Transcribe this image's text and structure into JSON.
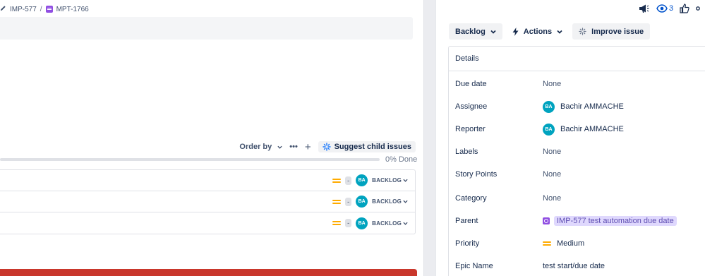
{
  "breadcrumb": {
    "epic": "IMP-577",
    "separator": "/",
    "story": "MPT-1766"
  },
  "child_issues": {
    "order_label": "Order by",
    "more_label": "•••",
    "add_label": "+",
    "suggest_label": "Suggest child issues",
    "progress_percent": 0,
    "progress_text": "0% Done",
    "rows": [
      {
        "estimate": "-",
        "assignee_initials": "BA",
        "status": "BACKLOG"
      },
      {
        "estimate": "-",
        "assignee_initials": "BA",
        "status": "BACKLOG"
      },
      {
        "estimate": "-",
        "assignee_initials": "BA",
        "status": "BACKLOG"
      }
    ]
  },
  "header_icons": {
    "watch_count": "3"
  },
  "actions": {
    "status_label": "Backlog",
    "actions_label": "Actions",
    "improve_label": "Improve issue"
  },
  "details": {
    "heading": "Details",
    "fields": {
      "due_date": {
        "label": "Due date",
        "value": "None"
      },
      "assignee": {
        "label": "Assignee",
        "initials": "BA",
        "value": "Bachir AMMACHE"
      },
      "reporter": {
        "label": "Reporter",
        "initials": "BA",
        "value": "Bachir AMMACHE"
      },
      "labels": {
        "label": "Labels",
        "value": "None"
      },
      "story_points": {
        "label": "Story Points",
        "value": "None"
      },
      "category": {
        "label": "Category",
        "value": "None"
      },
      "parent": {
        "label": "Parent",
        "value": "IMP-577 test automation due date"
      },
      "priority": {
        "label": "Priority",
        "value": "Medium"
      },
      "epic_name": {
        "label": "Epic Name",
        "value": "test start/due date"
      }
    }
  },
  "colors": {
    "avatar": "#00a3bf",
    "priority_medium": "#ffab00",
    "link_blue": "#0052cc",
    "story_purple": "#904ee2",
    "danger_red": "#c9372c"
  }
}
